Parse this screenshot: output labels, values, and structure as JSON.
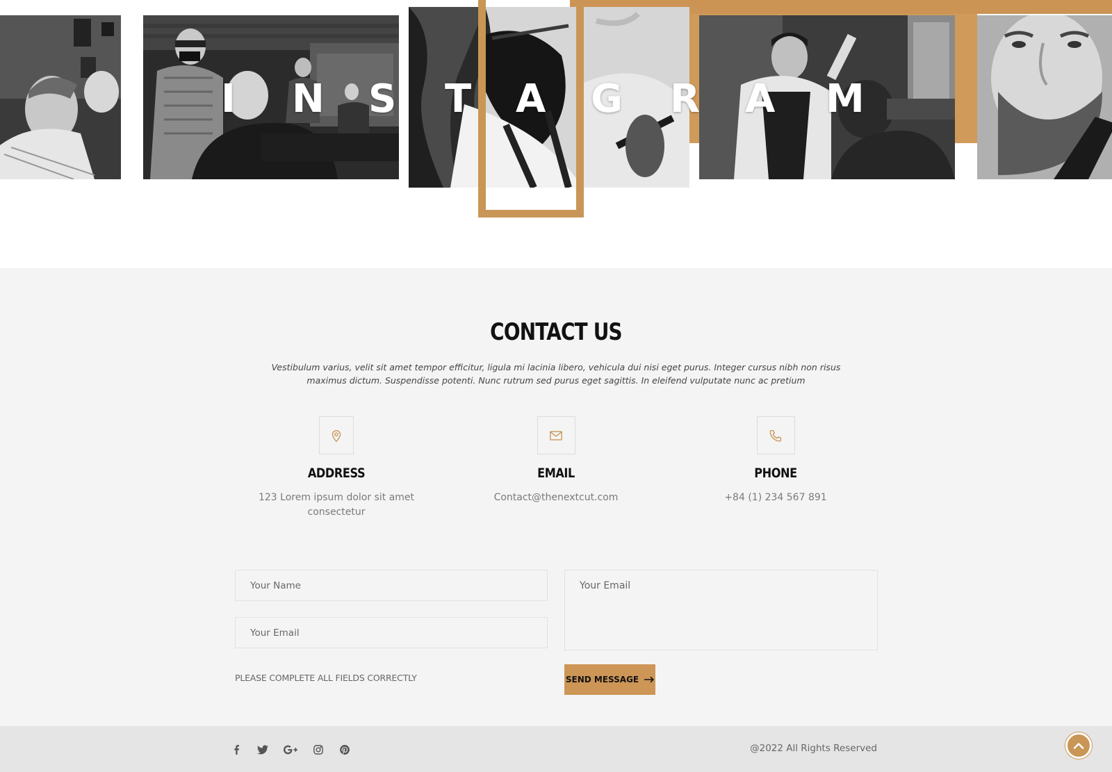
{
  "instagram": {
    "letters": [
      "I",
      "N",
      "S",
      "T",
      "A",
      "G",
      "R",
      "A",
      "M"
    ],
    "photos": [
      "barber-haircut-photo",
      "barber-masked-photo",
      "bearded-man-cigar-photo",
      "barber-vest-photo",
      "man-beard-trim-photo"
    ]
  },
  "contact": {
    "title": "CONTACT US",
    "description": "Vestibulum varius, velit sit amet tempor efficitur, ligula mi lacinia libero, vehicula dui nisi eget purus. Integer cursus nibh non risus maximus dictum. Suspendisse potenti. Nunc rutrum sed purus eget sagittis. In eleifend vulputate nunc ac pretium",
    "address": {
      "title": "ADDRESS",
      "value": "123 Lorem ipsum dolor sit amet consectetur",
      "icon": "map-pin-icon"
    },
    "email": {
      "title": "EMAIL",
      "value": "Contact@thenextcut.com",
      "icon": "envelope-icon"
    },
    "phone": {
      "title": "PHONE",
      "value": "+84 (1) 234 567 891",
      "icon": "phone-icon"
    }
  },
  "form": {
    "name_placeholder": "Your Name",
    "email_placeholder": "Your Email",
    "message_placeholder": "Your Email",
    "note": "PLEASE COMPLETE ALL FIELDS CORRECTLY",
    "send_label": "SEND MESSAGE"
  },
  "footer": {
    "social": [
      "facebook-icon",
      "twitter-icon",
      "google-plus-icon",
      "instagram-icon",
      "pinterest-icon"
    ],
    "copyright": "@2022 All Rights Reserved"
  },
  "colors": {
    "accent": "#c99657",
    "section_bg": "#f4f4f4",
    "footer_bg": "#e5e5e5"
  }
}
